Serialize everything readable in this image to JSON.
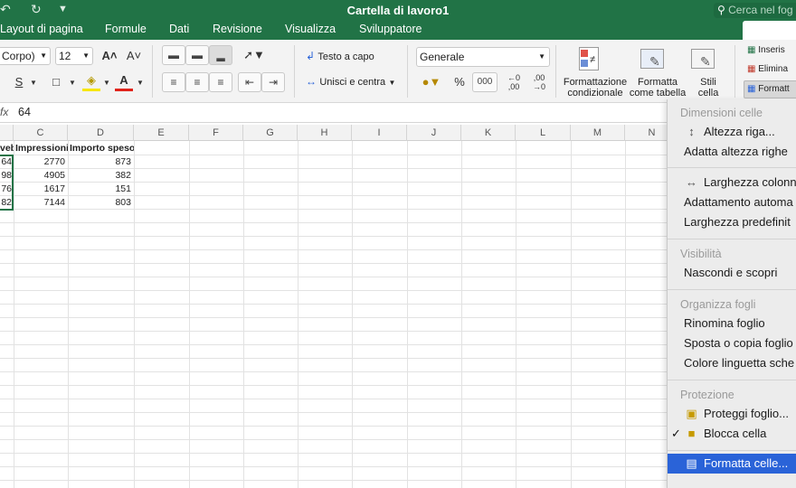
{
  "window": {
    "title": "Cartella di lavoro1",
    "search_placeholder": "Cerca nel fog"
  },
  "tabs": [
    "Layout di pagina",
    "Formule",
    "Dati",
    "Revisione",
    "Visualizza",
    "Sviluppatore"
  ],
  "ribbon": {
    "font_name": "Corpo)",
    "font_size": "12",
    "grow_font": "A˄",
    "shrink_font": "A˅",
    "underline": "S",
    "wrap_text": "Testo a capo",
    "merge_center": "Unisci e centra",
    "number_format": "Generale",
    "percent": "%",
    "thousands": "000",
    "conditional_format": [
      "Formattazione",
      "condizionale"
    ],
    "format_table": [
      "Formatta",
      "come tabella"
    ],
    "cell_styles": [
      "Stili",
      "cella"
    ],
    "insert": "Inseris",
    "delete": "Elimina",
    "format": "Formatt"
  },
  "formula_bar": {
    "fx_label": "fx",
    "value": "64"
  },
  "columns": [
    "C",
    "D",
    "E",
    "F",
    "G",
    "H",
    "I",
    "J",
    "K",
    "L",
    "M",
    "N"
  ],
  "table": {
    "headers": [
      "veb",
      "Impressioni",
      "Importo speso"
    ],
    "rows": [
      [
        "64",
        "2770",
        "873"
      ],
      [
        "98",
        "4905",
        "382"
      ],
      [
        "76",
        "1617",
        "151"
      ],
      [
        "82",
        "7144",
        "803"
      ]
    ]
  },
  "menu": {
    "sections": {
      "cell_size": "Dimensioni celle",
      "visibility": "Visibilità",
      "organize": "Organizza fogli",
      "protection": "Protezione"
    },
    "items": {
      "row_height": "Altezza riga...",
      "autofit_rows": "Adatta altezza righe",
      "column_width": "Larghezza colonn",
      "autofit_cols": "Adattamento automa",
      "default_width": "Larghezza predefinit",
      "hide_show": "Nascondi e scopri",
      "rename": "Rinomina foglio",
      "move_copy": "Sposta o copia foglio",
      "tab_color": "Colore linguetta sche",
      "protect_sheet": "Proteggi foglio...",
      "lock_cell": "Blocca cella",
      "format_cells": "Formatta celle..."
    },
    "check_mark": "✓"
  }
}
